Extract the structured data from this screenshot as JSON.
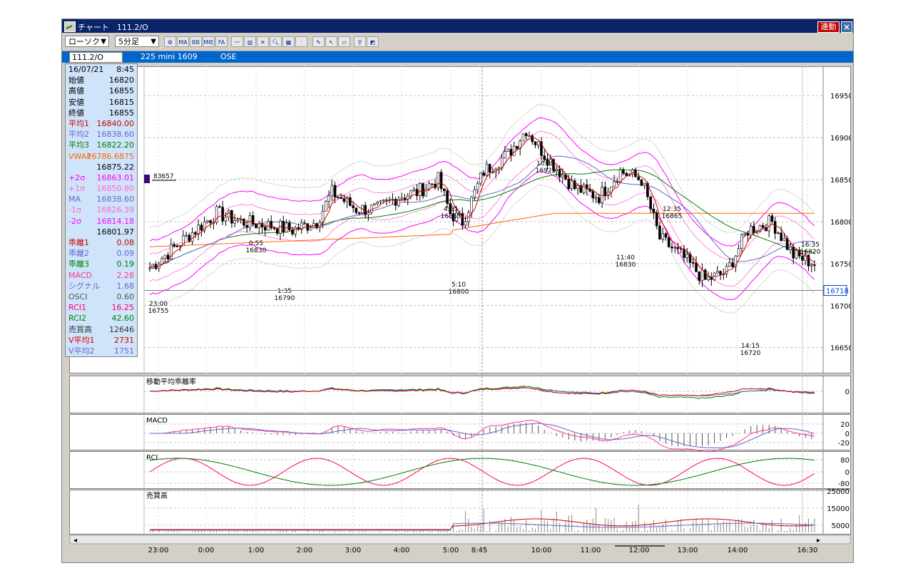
{
  "window": {
    "title": "チャート　111.2/O",
    "link_button": "連動",
    "close": "×"
  },
  "toolbar": {
    "chart_type": "ローソク",
    "interval": "5分足",
    "tools": [
      "chart-settings",
      "MA",
      "BB",
      "MIE",
      "FA",
      "line-chart",
      "candle-chart",
      "chart-mode",
      "zoom",
      "table",
      "bars",
      "pen",
      "cursor",
      "eraser",
      "search",
      "layout"
    ]
  },
  "symbol": {
    "code": "111.2/O",
    "name": "225 mini 1609",
    "exchange": "OSE"
  },
  "info_panel": {
    "rows": [
      {
        "label": "16/07/21",
        "value": "8:45",
        "color": "#000000"
      },
      {
        "label": "始値",
        "value": "16820",
        "color": "#000000"
      },
      {
        "label": "高値",
        "value": "16855",
        "color": "#000000"
      },
      {
        "label": "安値",
        "value": "16815",
        "color": "#000000"
      },
      {
        "label": "終値",
        "value": "16855",
        "color": "#000000"
      },
      {
        "label": "平均1",
        "value": "16840.00",
        "color": "#cc0000"
      },
      {
        "label": "平均2",
        "value": "16838.60",
        "color": "#6666cc"
      },
      {
        "label": "平均3",
        "value": "16822.20",
        "color": "#008000"
      },
      {
        "label": "VWAP",
        "value": "16786.6875",
        "color": "#ff6600"
      },
      {
        "label": "",
        "value": "16875.22",
        "color": "#000000"
      },
      {
        "label": "+2σ",
        "value": "16863.01",
        "color": "#ff00ff"
      },
      {
        "label": "+1σ",
        "value": "16850.80",
        "color": "#ff66cc"
      },
      {
        "label": "MA",
        "value": "16838.60",
        "color": "#6666cc"
      },
      {
        "label": "-1σ",
        "value": "16826.39",
        "color": "#ff66cc"
      },
      {
        "label": "-2σ",
        "value": "16814.18",
        "color": "#ff00ff"
      },
      {
        "label": "",
        "value": "16801.97",
        "color": "#000000"
      },
      {
        "label": "乖離1",
        "value": "0.08",
        "color": "#cc0000"
      },
      {
        "label": "乖離2",
        "value": "0.09",
        "color": "#6666cc"
      },
      {
        "label": "乖離3",
        "value": "0.19",
        "color": "#008000"
      },
      {
        "label": "MACD",
        "value": "2.28",
        "color": "#ff3399"
      },
      {
        "label": "シグナル",
        "value": "1.68",
        "color": "#6666cc"
      },
      {
        "label": "OSCI",
        "value": "0.60",
        "color": "#555555"
      },
      {
        "label": "RCI1",
        "value": "16.25",
        "color": "#ff0066"
      },
      {
        "label": "RCI2",
        "value": "42.60",
        "color": "#008000"
      },
      {
        "label": "売買高",
        "value": "12646",
        "color": "#333333"
      },
      {
        "label": "V平均1",
        "value": "2731",
        "color": "#cc0000"
      },
      {
        "label": "V平均2",
        "value": "1751",
        "color": "#6666cc"
      }
    ]
  },
  "main_chart": {
    "price_axis": [
      "16950",
      "16900",
      "16850",
      "16800",
      "16750",
      "16700",
      "16650"
    ],
    "current_price": "16718",
    "marker_label": "83657",
    "annotations": [
      {
        "time": "23:00",
        "price": "16755"
      },
      {
        "time": "0:55",
        "price": "16830"
      },
      {
        "time": "1:35",
        "price": "16790"
      },
      {
        "time": "4:55",
        "price": "16865"
      },
      {
        "time": "5:10",
        "price": "16800"
      },
      {
        "time": "10:05",
        "price": "16925"
      },
      {
        "time": "11:40",
        "price": "16830"
      },
      {
        "time": "12:35",
        "price": "16865"
      },
      {
        "time": "14:15",
        "price": "16720"
      },
      {
        "time": "16:35",
        "price": "16820"
      }
    ]
  },
  "sub_panels": [
    {
      "title": "移動平均乖離率",
      "axis": [
        "0"
      ]
    },
    {
      "title": "MACD",
      "axis": [
        "20",
        "0",
        "-20"
      ]
    },
    {
      "title": "RCI",
      "axis": [
        "80",
        "0",
        "-80"
      ]
    },
    {
      "title": "売買高",
      "axis": [
        "25000",
        "15000",
        "5000"
      ]
    }
  ],
  "time_axis": [
    "23:00",
    "0:00",
    "1:00",
    "2:00",
    "3:00",
    "4:00",
    "5:00",
    "8:45",
    "10:00",
    "11:00",
    "12:00",
    "13:00",
    "14:00",
    "16:30"
  ]
}
